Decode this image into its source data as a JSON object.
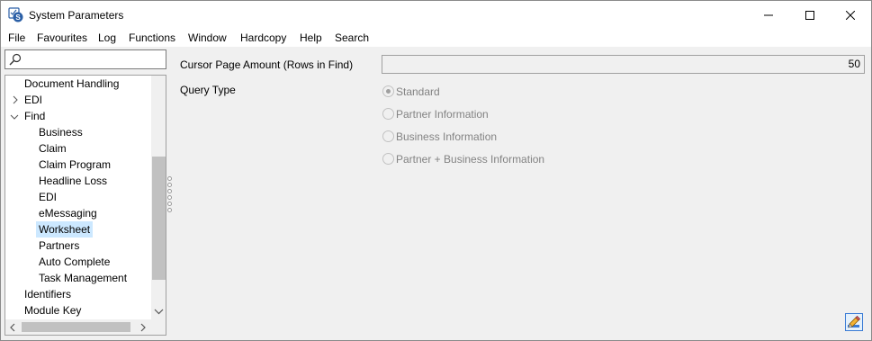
{
  "window": {
    "title": "System Parameters"
  },
  "menu": [
    "File",
    "Favourites",
    "Log",
    "Functions",
    "Window",
    "Hardcopy",
    "Help",
    "Search"
  ],
  "search": {
    "value": "",
    "placeholder": ""
  },
  "tree": {
    "items": [
      {
        "label": "Document Handling",
        "level": 1,
        "chevron": "none",
        "selected": false
      },
      {
        "label": "EDI",
        "level": 1,
        "chevron": "right",
        "selected": false
      },
      {
        "label": "Find",
        "level": 1,
        "chevron": "down",
        "selected": false
      },
      {
        "label": "Business",
        "level": 2,
        "chevron": "none",
        "selected": false
      },
      {
        "label": "Claim",
        "level": 2,
        "chevron": "none",
        "selected": false
      },
      {
        "label": "Claim Program",
        "level": 2,
        "chevron": "none",
        "selected": false
      },
      {
        "label": "Headline Loss",
        "level": 2,
        "chevron": "none",
        "selected": false
      },
      {
        "label": "EDI",
        "level": 2,
        "chevron": "none",
        "selected": false
      },
      {
        "label": "eMessaging",
        "level": 2,
        "chevron": "none",
        "selected": false
      },
      {
        "label": "Worksheet",
        "level": 2,
        "chevron": "none",
        "selected": true
      },
      {
        "label": "Partners",
        "level": 2,
        "chevron": "none",
        "selected": false
      },
      {
        "label": "Auto Complete",
        "level": 2,
        "chevron": "none",
        "selected": false
      },
      {
        "label": "Task Management",
        "level": 2,
        "chevron": "none",
        "selected": false
      },
      {
        "label": "Identifiers",
        "level": 1,
        "chevron": "none",
        "selected": false
      },
      {
        "label": "Module Key",
        "level": 1,
        "chevron": "none",
        "selected": false
      }
    ]
  },
  "form": {
    "cursor_label": "Cursor Page Amount (Rows in Find)",
    "cursor_value": "50",
    "query_label": "Query Type",
    "query_options": [
      {
        "label": "Standard",
        "selected": true
      },
      {
        "label": "Partner Information",
        "selected": false
      },
      {
        "label": "Business Information",
        "selected": false
      },
      {
        "label": "Partner + Business Information",
        "selected": false
      }
    ]
  },
  "colors": {
    "selection": "#cce8ff",
    "disabled_text": "#838383",
    "background": "#f0f0f0"
  }
}
